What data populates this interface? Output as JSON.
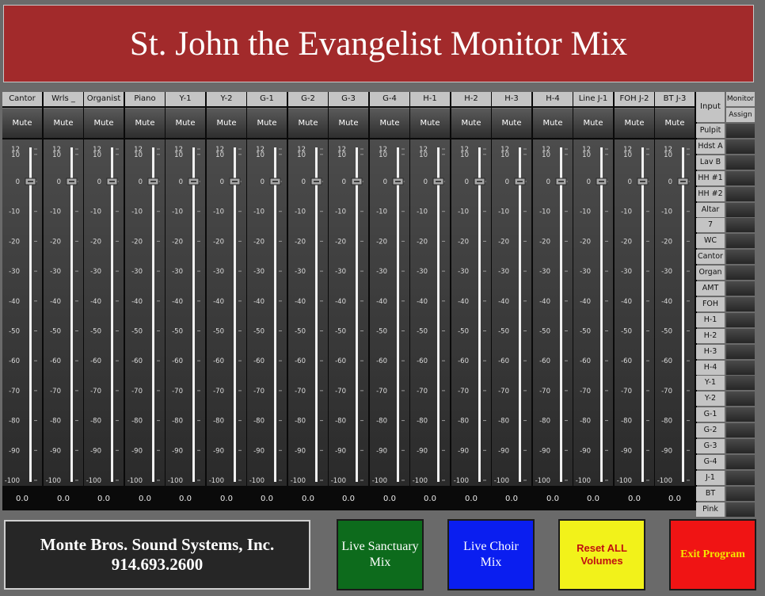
{
  "title": "St. John the Evangelist Monitor Mix",
  "mute_label": "Mute",
  "scale_labels": [
    "12",
    "10",
    "0",
    "-10",
    "-20",
    "-30",
    "-40",
    "-50",
    "-60",
    "-70",
    "-80",
    "-90",
    "-100"
  ],
  "channels": [
    {
      "name": "Cantor",
      "value": "0.0",
      "level_db": 0
    },
    {
      "name": "Wrls _",
      "value": "0.0",
      "level_db": 0
    },
    {
      "name": "Organist",
      "value": "0.0",
      "level_db": 0
    },
    {
      "name": "Piano",
      "value": "0.0",
      "level_db": 0
    },
    {
      "name": "Y-1",
      "value": "0.0",
      "level_db": 0
    },
    {
      "name": "Y-2",
      "value": "0.0",
      "level_db": 0
    },
    {
      "name": "G-1",
      "value": "0.0",
      "level_db": 0
    },
    {
      "name": "G-2",
      "value": "0.0",
      "level_db": 0
    },
    {
      "name": "G-3",
      "value": "0.0",
      "level_db": 0
    },
    {
      "name": "G-4",
      "value": "0.0",
      "level_db": 0
    },
    {
      "name": "H-1",
      "value": "0.0",
      "level_db": 0
    },
    {
      "name": "H-2",
      "value": "0.0",
      "level_db": 0
    },
    {
      "name": "H-3",
      "value": "0.0",
      "level_db": 0
    },
    {
      "name": "H-4",
      "value": "0.0",
      "level_db": 0
    },
    {
      "name": "Line J-1",
      "value": "0.0",
      "level_db": 0
    },
    {
      "name": "FOH J-2",
      "value": "0.0",
      "level_db": 0
    },
    {
      "name": "BT J-3",
      "value": "0.0",
      "level_db": 0
    }
  ],
  "side_panel": {
    "input_header": "Input",
    "monitor_header": "Monitor",
    "assign_header": "Assign",
    "inputs": [
      "Pulpit",
      "Hdst A",
      "Lav B",
      "HH #1",
      "HH #2",
      "Altar",
      "7",
      "WC",
      "Cantor",
      "Organ",
      "AMT",
      "FOH",
      "H-1",
      "H-2",
      "H-3",
      "H-4",
      "Y-1",
      "Y-2",
      "G-1",
      "G-2",
      "G-3",
      "G-4",
      "J-1",
      "BT",
      "Pink"
    ]
  },
  "company": {
    "name": "Monte Bros. Sound Systems, Inc.",
    "phone": "914.693.2600"
  },
  "buttons": {
    "live_sanctuary": "Live Sanctuary Mix",
    "live_choir": "Live Choir Mix",
    "reset_all": "Reset ALL Volumes",
    "exit": "Exit Program"
  },
  "colors": {
    "title_bg": "#a22a2b",
    "live_sanctuary_bg": "#0d6b1c",
    "live_choir_bg": "#0a1ef0",
    "reset_bg": "#f2f21a",
    "exit_bg": "#f01414"
  }
}
